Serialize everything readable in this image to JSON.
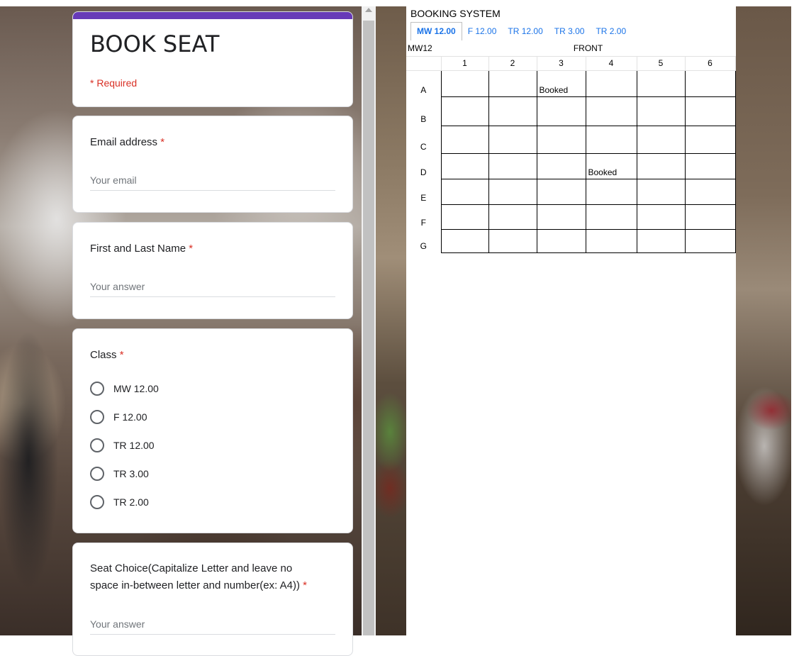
{
  "form": {
    "title": "BOOK SEAT",
    "required_note": "* Required",
    "accent_color": "#673ab7",
    "required_color": "#d93025",
    "email": {
      "label": "Email address",
      "required_mark": "*",
      "placeholder": "Your email"
    },
    "name": {
      "label": "First and Last Name",
      "required_mark": "*",
      "placeholder": "Your answer"
    },
    "class": {
      "label": "Class",
      "required_mark": "*",
      "options": [
        "MW 12.00",
        "F 12.00",
        "TR 12.00",
        "TR 3.00",
        "TR 2.00"
      ]
    },
    "seat": {
      "label_line1": "Seat Choice(Capitalize Letter and leave no",
      "label_line2": "space in-between letter and number(ex: A4))",
      "required_mark": "*",
      "placeholder": "Your answer"
    }
  },
  "sheet": {
    "title": "BOOKING SYSTEM",
    "tabs": [
      "MW 12.00",
      "F 12.00",
      "TR 12.00",
      "TR 3.00",
      "TR 2.00"
    ],
    "active_tab": "MW 12.00",
    "sheet_name": "MW12",
    "front_label": "FRONT",
    "columns": [
      "1",
      "2",
      "3",
      "4",
      "5",
      "6"
    ],
    "rows": [
      {
        "label": "A",
        "cells": [
          "",
          "",
          "Booked",
          "",
          "",
          ""
        ]
      },
      {
        "label": "B",
        "cells": [
          "",
          "",
          "",
          "",
          "",
          ""
        ]
      },
      {
        "label": "C",
        "cells": [
          "",
          "",
          "",
          "",
          "",
          ""
        ]
      },
      {
        "label": "D",
        "cells": [
          "",
          "",
          "",
          "Booked",
          "",
          ""
        ]
      },
      {
        "label": "E",
        "cells": [
          "",
          "",
          "",
          "",
          "",
          ""
        ]
      },
      {
        "label": "F",
        "cells": [
          "",
          "",
          "",
          "",
          "",
          ""
        ]
      },
      {
        "label": "G",
        "cells": [
          "",
          "",
          "",
          "",
          "",
          ""
        ]
      }
    ]
  }
}
